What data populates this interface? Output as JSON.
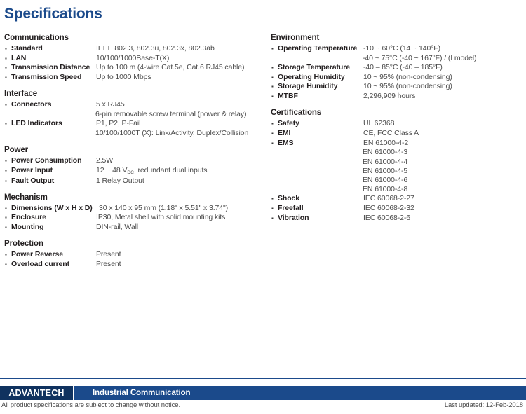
{
  "page_title": "Specifications",
  "accent_color": "#1b4a8b",
  "text_color": "#231f20",
  "value_color": "#4a4a4a",
  "left_column": [
    {
      "title": "Communications",
      "rows": [
        {
          "label": "Standard",
          "values": [
            "IEEE 802.3, 802.3u, 802.3x, 802.3ab"
          ]
        },
        {
          "label": "LAN",
          "values": [
            "10/100/1000Base-T(X)"
          ]
        },
        {
          "label": "Transmission Distance",
          "values": [
            "Up to 100 m (4-wire Cat.5e, Cat.6 RJ45 cable)"
          ]
        },
        {
          "label": "Transmission Speed",
          "values": [
            "Up to 1000 Mbps"
          ]
        }
      ]
    },
    {
      "title": "Interface",
      "rows": [
        {
          "label": "Connectors",
          "values": [
            "5 x RJ45",
            "6-pin removable screw terminal (power & relay)"
          ]
        },
        {
          "label": "LED Indicators",
          "values": [
            "P1, P2, P-Fail",
            "10/100/1000T (X): Link/Activity, Duplex/Collision"
          ]
        }
      ]
    },
    {
      "title": "Power",
      "rows": [
        {
          "label": "Power Consumption",
          "values": [
            "2.5W"
          ]
        },
        {
          "label": "Power Input",
          "values": [
            "12 ~ 48 VDC, redundant dual inputs"
          ],
          "subscript": {
            "before": "12 ~ 48 V",
            "sub": "DC",
            "after": ", redundant dual inputs"
          }
        },
        {
          "label": "Fault Output",
          "values": [
            "1 Relay Output"
          ]
        }
      ]
    },
    {
      "title": "Mechanism",
      "rows": [
        {
          "label": "Dimensions (W x H x D)",
          "values": [
            "30 x 140 x 95 mm (1.18\" x 5.51\" x 3.74\")"
          ],
          "wide_label": true
        },
        {
          "label": "Enclosure",
          "values": [
            "IP30, Metal shell with solid mounting kits"
          ]
        },
        {
          "label": "Mounting",
          "values": [
            "DIN-rail, Wall"
          ]
        }
      ]
    },
    {
      "title": "Protection",
      "rows": [
        {
          "label": "Power Reverse",
          "values": [
            "Present"
          ]
        },
        {
          "label": "Overload current",
          "values": [
            "Present"
          ]
        }
      ]
    }
  ],
  "right_column": [
    {
      "title": "Environment",
      "rows": [
        {
          "label": "Operating Temperature",
          "values": [
            "-10 ~ 60°C (14 ~ 140°F)",
            "-40 ~ 75°C (-40 ~ 167°F) / (I model)"
          ]
        },
        {
          "label": "Storage Temperature",
          "values": [
            "-40 – 85°C (-40 – 185°F)"
          ]
        },
        {
          "label": "Operating Humidity",
          "values": [
            "10 ~ 95% (non-condensing)"
          ]
        },
        {
          "label": "Storage Humidity",
          "values": [
            "10 ~ 95% (non-condensing)"
          ]
        },
        {
          "label": "MTBF",
          "values": [
            "2,296,909 hours"
          ]
        }
      ]
    },
    {
      "title": "Certifications",
      "rows": [
        {
          "label": "Safety",
          "values": [
            "UL 62368"
          ]
        },
        {
          "label": "EMI",
          "values": [
            "CE, FCC Class A"
          ]
        },
        {
          "label": "EMS",
          "values": [
            "EN 61000-4-2",
            "EN 61000-4-3",
            "EN 61000-4-4",
            "EN 61000-4-5",
            "EN 61000-4-6",
            "EN 61000-4-8"
          ]
        },
        {
          "label": "Shock",
          "values": [
            "IEC 60068-2-27"
          ]
        },
        {
          "label": "Freefall",
          "values": [
            "IEC 60068-2-32"
          ]
        },
        {
          "label": "Vibration",
          "values": [
            "IEC 60068-2-6"
          ]
        }
      ]
    }
  ],
  "footer": {
    "brand": "ADVANTECH",
    "tagline": "Industrial Communication",
    "disclaimer": "All product specifications are subject to change without notice.",
    "last_updated": "Last updated: 12-Feb-2018"
  }
}
